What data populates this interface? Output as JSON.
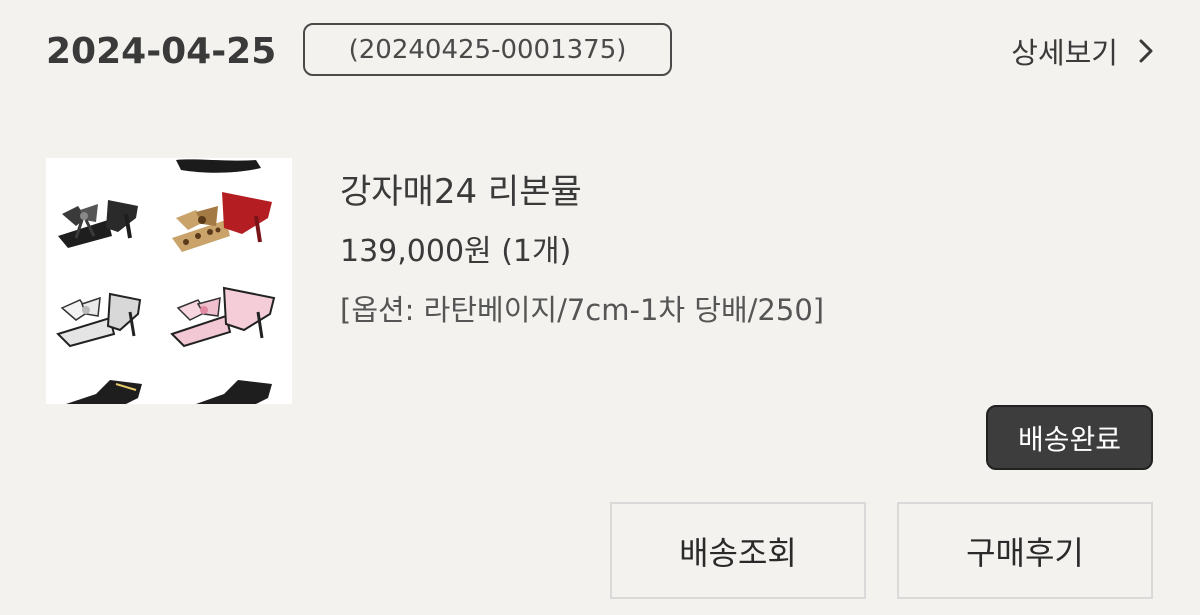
{
  "order": {
    "date": "2024-04-25",
    "number": "(20240425-0001375)",
    "detail_label": "상세보기"
  },
  "product": {
    "image_icon": "sandals-product-image",
    "name": "강자매24 리본뮬",
    "price": "139,000원 (1개)",
    "option": "[옵션: 라탄베이지/7cm-1차 당배/250]"
  },
  "status": {
    "label": "배송완료"
  },
  "actions": {
    "track_label": "배송조회",
    "review_label": "구매후기"
  },
  "colors": {
    "background": "#f3f2ee",
    "badge_bg": "#3d3d3d",
    "text": "#3a3a3a"
  }
}
